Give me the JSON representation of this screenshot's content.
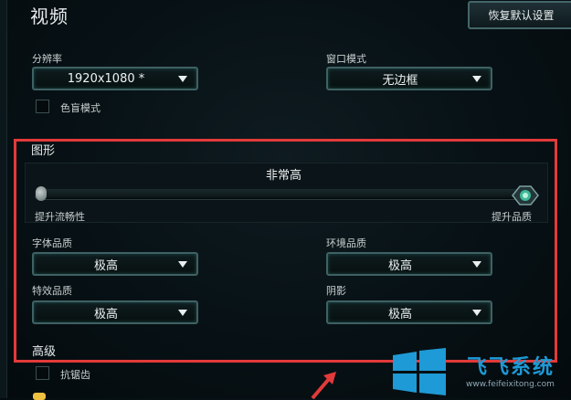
{
  "title": "视频",
  "reset_button": "恢复默认设置",
  "resolution": {
    "label": "分辨率",
    "value": "1920x1080 *"
  },
  "window_mode": {
    "label": "窗口模式",
    "value": "无边框"
  },
  "colorblind": {
    "label": "色盲模式"
  },
  "graphics": {
    "section_title": "图形",
    "preset": "非常高",
    "left_label": "提升流畅性",
    "right_label": "提升品质",
    "slider_fraction": 1.0
  },
  "character_quality": {
    "label": "字体品质",
    "value": "极高"
  },
  "environment_quality": {
    "label": "环境品质",
    "value": "极高"
  },
  "effects_quality": {
    "label": "特效品质",
    "value": "极高"
  },
  "shadows": {
    "label": "阴影",
    "value": "极高"
  },
  "advanced": {
    "section_title": "高级",
    "antialias": "抗锯齿"
  },
  "watermark": {
    "brand": "飞飞系统",
    "url": "www.feifeixitong.com"
  },
  "colors": {
    "accent": "#3f6163",
    "highlight": "#e23a3a",
    "brand": "#1e9ad6"
  }
}
